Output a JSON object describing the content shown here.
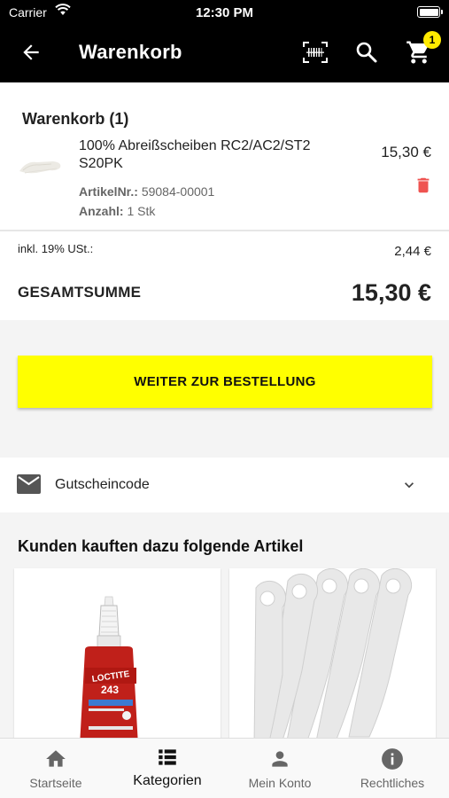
{
  "status_bar": {
    "carrier": "Carrier",
    "time": "12:30 PM"
  },
  "app_bar": {
    "title": "Warenkorb",
    "cart_badge": "1"
  },
  "cart": {
    "heading": "Warenkorb (1)",
    "item": {
      "name": "100% Abreißscheiben RC2/AC2/ST2 S20PK",
      "price": "15,30 €",
      "article_label": "ArtikelNr.:",
      "article_number": "59084-00001",
      "quantity_label": "Anzahl:",
      "quantity_value": "1 Stk"
    },
    "tax_label": "inkl. 19% USt.:",
    "tax_value": "2,44 €",
    "total_label": "GESAMTSUMME",
    "total_value": "15,30 €"
  },
  "order_button": {
    "label": "WEITER ZUR BESTELLUNG"
  },
  "voucher": {
    "label": "Gutscheincode"
  },
  "recommendations": {
    "title": "Kunden kauften dazu folgende Artikel",
    "items": [
      {
        "image": "loctite-243-bottle",
        "brand_text": "LOCTITE",
        "model_text": "243"
      },
      {
        "image": "tear-off-strips"
      }
    ]
  },
  "bottom_nav": {
    "items": [
      {
        "label": "Startseite",
        "icon": "home-icon"
      },
      {
        "label": "Kategorien",
        "icon": "list-icon"
      },
      {
        "label": "Mein Konto",
        "icon": "person-icon"
      },
      {
        "label": "Rechtliches",
        "icon": "info-icon"
      }
    ],
    "active": "Kategorien"
  },
  "colors": {
    "accent": "#ffff00",
    "badge": "#ffea00",
    "delete": "#ef5350",
    "appbar": "#000000"
  }
}
